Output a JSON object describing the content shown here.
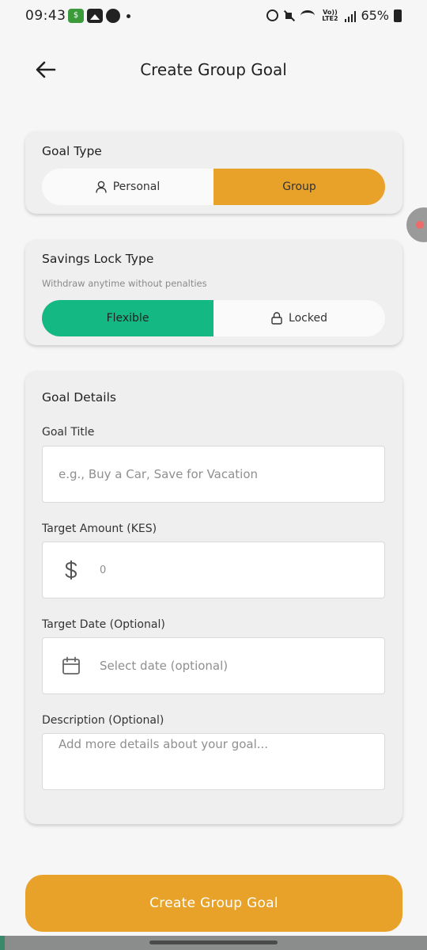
{
  "status_bar": {
    "time": "09:43",
    "money_app_glyph": "$",
    "battery": "65%",
    "network_label": "Vo)) LTE2"
  },
  "header": {
    "back_icon": "arrow-left-icon",
    "title": "Create Group Goal"
  },
  "goal_type": {
    "title": "Goal Type",
    "options": [
      {
        "label": "Personal",
        "icon": "person-icon",
        "selected": false
      },
      {
        "label": "Group",
        "selected": true
      }
    ]
  },
  "lock_type": {
    "title": "Savings Lock Type",
    "subtitle": "Withdraw anytime without penalties",
    "options": [
      {
        "label": "Flexible",
        "selected": true
      },
      {
        "label": "Locked",
        "icon": "lock-icon",
        "selected": false
      }
    ]
  },
  "details": {
    "title": "Goal Details",
    "goal_title": {
      "label": "Goal Title",
      "placeholder": "e.g., Buy a Car, Save for Vacation"
    },
    "target_amount": {
      "label": "Target Amount (KES)",
      "placeholder": "0",
      "icon": "dollar-icon"
    },
    "target_date": {
      "label": "Target Date (Optional)",
      "placeholder": "Select date (optional)",
      "icon": "calendar-icon"
    },
    "description": {
      "label": "Description (Optional)",
      "placeholder": "Add more details about your goal..."
    }
  },
  "submit_label": "Create Group Goal",
  "colors": {
    "accent_orange": "#e8a22a",
    "accent_green": "#14b882",
    "background": "#f6f6f6",
    "card": "#efefef"
  }
}
